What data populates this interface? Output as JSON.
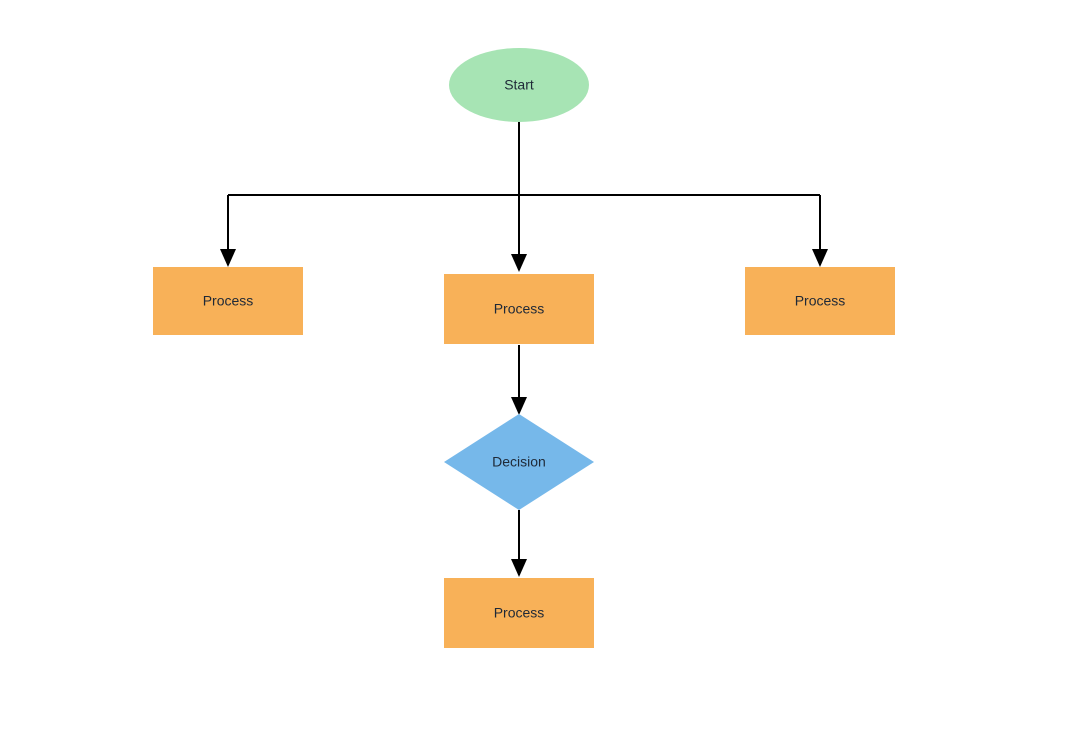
{
  "nodes": {
    "start": {
      "label": "Start",
      "shape": "terminator"
    },
    "processLeft": {
      "label": "Process",
      "shape": "process"
    },
    "processCenter": {
      "label": "Process",
      "shape": "process"
    },
    "processRight": {
      "label": "Process",
      "shape": "process"
    },
    "decision": {
      "label": "Decision",
      "shape": "decision"
    },
    "processBottom": {
      "label": "Process",
      "shape": "process"
    }
  },
  "colors": {
    "terminator": "#a7e4b4",
    "process": "#f8b158",
    "decision": "#76b8ea",
    "connector": "#000000"
  },
  "edges": [
    {
      "from": "start",
      "to": "processLeft"
    },
    {
      "from": "start",
      "to": "processCenter"
    },
    {
      "from": "start",
      "to": "processRight"
    },
    {
      "from": "processCenter",
      "to": "decision"
    },
    {
      "from": "decision",
      "to": "processBottom"
    }
  ]
}
